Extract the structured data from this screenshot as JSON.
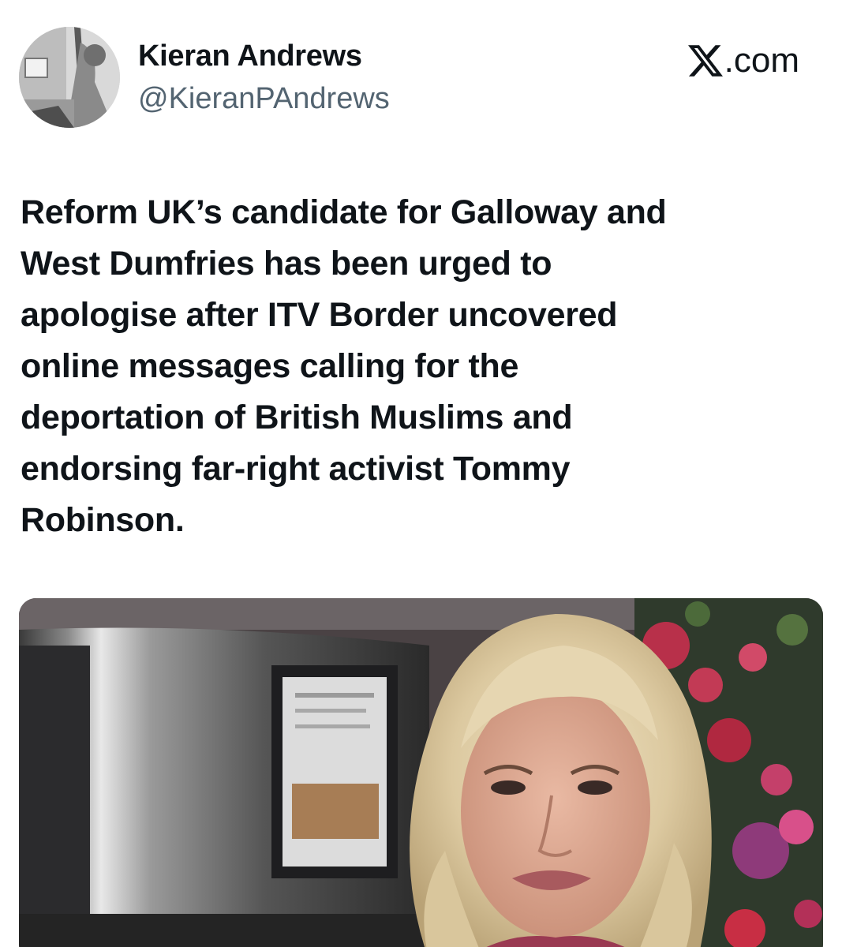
{
  "author": {
    "display_name": "Kieran Andrews",
    "handle": "@KieranPAndrews"
  },
  "brand": {
    "label": ".com",
    "icon": "x-logo-icon"
  },
  "tweet": {
    "lines": [
      "Reform UK’s candidate for Galloway and",
      "West Dumfries has been urged to",
      "apologise after ITV Border uncovered",
      "online messages calling for the",
      "deportation of British Muslims and",
      "endorsing far-right activist Tommy",
      "Robinson."
    ]
  },
  "colors": {
    "text": "#0f1419",
    "secondary_text": "#536471",
    "background": "#ffffff"
  }
}
